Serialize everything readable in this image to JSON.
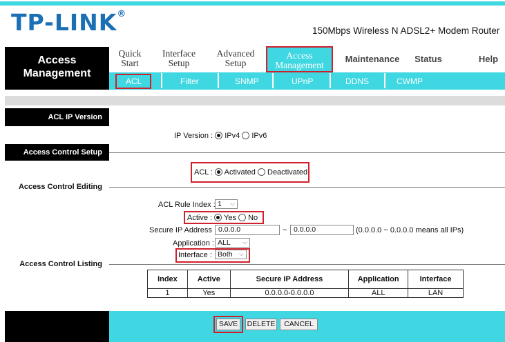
{
  "header": {
    "brand": "TP-LINK",
    "brand_mark": "®",
    "model": "150Mbps Wireless N ADSL2+ Modem Router"
  },
  "nav": {
    "section_title": "Access Management",
    "items": [
      {
        "label": "Quick Start"
      },
      {
        "label": "Interface Setup"
      },
      {
        "label": "Advanced Setup"
      },
      {
        "label": "Access Management"
      },
      {
        "label": "Maintenance"
      },
      {
        "label": "Status"
      },
      {
        "label": "Help"
      }
    ],
    "subitems": [
      {
        "label": "ACL"
      },
      {
        "label": "Filter"
      },
      {
        "label": "SNMP"
      },
      {
        "label": "UPnP"
      },
      {
        "label": "DDNS"
      },
      {
        "label": "CWMP"
      }
    ]
  },
  "sections": {
    "acl_ip_version": "ACL IP Version",
    "access_control_setup": "Access Control Setup",
    "access_control_editing": "Access Control Editing",
    "access_control_listing": "Access Control Listing"
  },
  "form": {
    "ip_version_label": "IP Version :",
    "ipv4": "IPv4",
    "ipv6": "IPv6",
    "acl_label": "ACL :",
    "activated": "Activated",
    "deactivated": "Deactivated",
    "rule_index_label": "ACL Rule Index :",
    "rule_index_value": "1",
    "active_label": "Active :",
    "yes": "Yes",
    "no": "No",
    "secure_ip_label": "Secure IP Address :",
    "ip_start": "0.0.0.0",
    "tilde": "~",
    "ip_end": "0.0.0.0",
    "ip_hint": "(0.0.0.0 ~ 0.0.0.0 means all IPs)",
    "application_label": "Application :",
    "application_value": "ALL",
    "interface_label": "Interface :",
    "interface_value": "Both"
  },
  "table": {
    "headers": [
      "Index",
      "Active",
      "Secure IP Address",
      "Application",
      "Interface"
    ],
    "rows": [
      [
        "1",
        "Yes",
        "0.0.0.0-0.0.0.0",
        "ALL",
        "LAN"
      ]
    ]
  },
  "buttons": {
    "save": "SAVE",
    "delete": "DELETE",
    "cancel": "CANCEL"
  },
  "colors": {
    "accent": "#3fd7e2",
    "brand_blue": "#1a6fb5",
    "highlight_red": "#d0202b"
  }
}
